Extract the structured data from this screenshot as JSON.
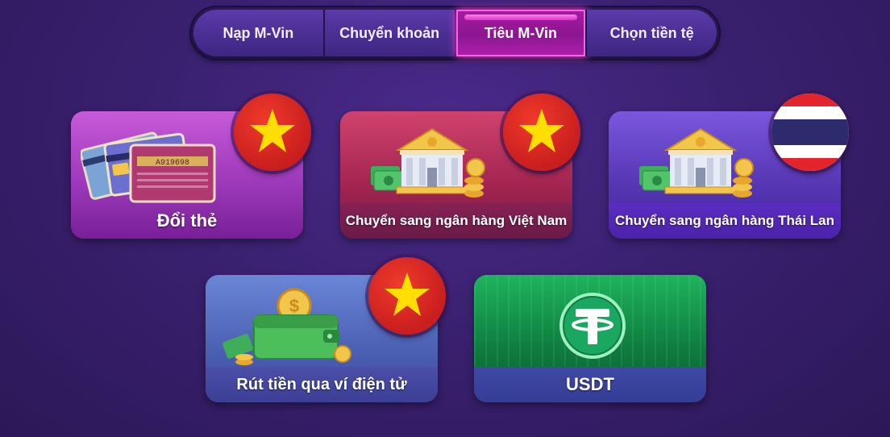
{
  "tabs": [
    {
      "label": "Nạp M-Vin",
      "active": false
    },
    {
      "label": "Chuyển khoản",
      "active": false
    },
    {
      "label": "Tiêu M-Vin",
      "active": true
    },
    {
      "label": "Chọn tiền tệ",
      "active": false
    }
  ],
  "cards": {
    "doi_the": {
      "label": "Đổi thẻ",
      "card_number": "A919698",
      "flag": "vietnam-flag-icon"
    },
    "bank_vn": {
      "label": "Chuyển sang ngân hàng Việt Nam",
      "flag": "vietnam-flag-icon"
    },
    "bank_th": {
      "label": "Chuyển sang ngân hàng Thái Lan",
      "flag": "thailand-flag-icon"
    },
    "wallet": {
      "label": "Rút tiền qua ví điện tử",
      "flag": "vietnam-flag-icon"
    },
    "usdt": {
      "label": "USDT"
    }
  },
  "colors": {
    "active_tab": "#a81ba0",
    "vn_red": "#da251d",
    "vn_star": "#ffde00",
    "usdt_green": "#26a17b"
  }
}
